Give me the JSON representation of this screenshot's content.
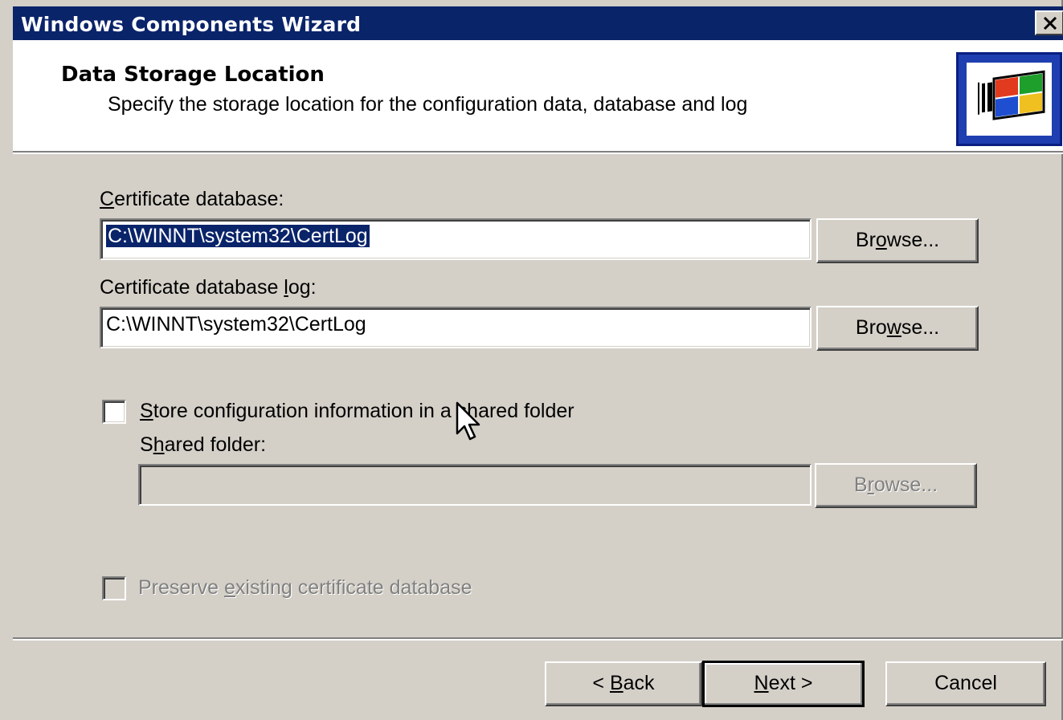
{
  "window": {
    "title": "Windows Components Wizard",
    "close_glyph": "close-icon"
  },
  "header": {
    "title": "Data Storage Location",
    "subtitle": "Specify the storage location for the configuration data, database and log",
    "logo_icon": "windows-logo-icon"
  },
  "cert_db": {
    "label_access_key": "C",
    "label_rest": "ertificate database:",
    "value": "C:\\WINNT\\system32\\CertLog",
    "browse_pre": "Br",
    "browse_key": "o",
    "browse_post": "wse..."
  },
  "cert_log": {
    "label_pre": "Certificate database ",
    "label_access_key": "l",
    "label_post": "og:",
    "value": "C:\\WINNT\\system32\\CertLog",
    "browse_pre": "Bro",
    "browse_key": "w",
    "browse_post": "se..."
  },
  "shared": {
    "checkbox_key": "S",
    "checkbox_rest": "tore configuration information in a shared folder",
    "checked": false,
    "folder_label_pre": "S",
    "folder_label_key": "h",
    "folder_label_post": "ared folder:",
    "folder_value": "",
    "browse_pre": "B",
    "browse_key": "r",
    "browse_post": "owse..."
  },
  "preserve": {
    "label_pre": "Preserve ",
    "label_key": "e",
    "label_post": "xisting certificate database",
    "checked": false
  },
  "footer": {
    "back_pre": "< ",
    "back_key": "B",
    "back_post": "ack",
    "next_key": "N",
    "next_post": "ext >",
    "cancel": "Cancel"
  },
  "colors": {
    "titlebar": "#0a246a",
    "face": "#d4d0c8",
    "selection": "#0a246a"
  }
}
